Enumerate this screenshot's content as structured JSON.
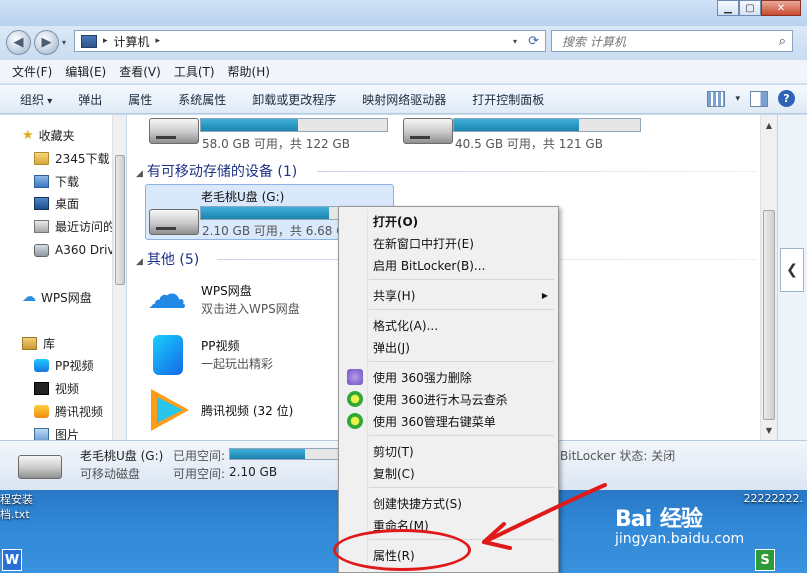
{
  "window": {
    "address": {
      "crumb": "计算机",
      "search_placeholder": "搜索 计算机"
    },
    "menubar": [
      "文件(F)",
      "编辑(E)",
      "查看(V)",
      "工具(T)",
      "帮助(H)"
    ],
    "commands": [
      "组织",
      "弹出",
      "属性",
      "系统属性",
      "卸载或更改程序",
      "映射网络驱动器",
      "打开控制面板"
    ]
  },
  "nav": {
    "favorites": "收藏夹",
    "items": [
      "2345下载",
      "下载",
      "桌面",
      "最近访问的",
      "A360 Driv"
    ],
    "wps": "WPS网盘",
    "library": "库",
    "lib_items": [
      "PP视频",
      "视频",
      "腾讯视频",
      "图片"
    ]
  },
  "content": {
    "drive_c": {
      "text": "58.0 GB 可用，共 122 GB",
      "used": 0.52
    },
    "drive_d": {
      "text": "40.5 GB 可用，共 121 GB",
      "used": 0.67
    },
    "group_removable": "有可移动存储的设备 (1)",
    "usb": {
      "name": "老毛桃U盘 (G:)",
      "text": "2.10 GB 可用，共 6.68 G",
      "used": 0.69
    },
    "group_other": "其他 (5)",
    "wps": {
      "name": "WPS网盘",
      "desc": "双击进入WPS网盘"
    },
    "pp": {
      "name": "PP视频",
      "desc": "一起玩出精彩"
    },
    "tx": {
      "name": "腾讯视频 (32 位)"
    }
  },
  "details": {
    "name": "老毛桃U盘 (G:)",
    "type": "可移动磁盘",
    "used_label": "已用空间:",
    "free_label": "可用空间:",
    "free": "2.10 GB",
    "used": 0.69,
    "bitlocker": "BitLocker 状态: 关闭"
  },
  "context_menu": {
    "open": "打开(O)",
    "open_new": "在新窗口中打开(E)",
    "bitlocker": "启用 BitLocker(B)...",
    "share": "共享(H)",
    "format": "格式化(A)...",
    "eject": "弹出(J)",
    "del360": "使用 360强力删除",
    "scan360": "使用 360进行木马云查杀",
    "mgr360": "使用 360管理右键菜单",
    "cut": "剪切(T)",
    "copy": "复制(C)",
    "shortcut": "创建快捷方式(S)",
    "rename": "重命名(M)",
    "properties": "属性(R)"
  },
  "desktop": {
    "label_left_1": "程安装",
    "label_left_2": "档.txt",
    "label_right": "22222222.",
    "watermark_logo": "Bai",
    "watermark_logo_cn": "经验",
    "watermark_url": "jingyan.baidu.com",
    "task_w": "W",
    "task_s": "S"
  },
  "colors": {
    "accent_bar": "#1a84ad",
    "highlight_red": "#e01a1a",
    "group_head": "#1e3287"
  }
}
